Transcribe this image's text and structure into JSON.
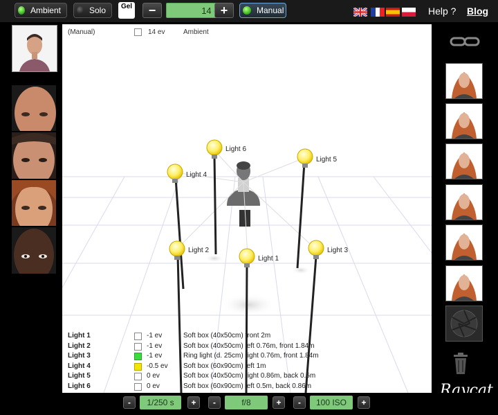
{
  "toolbar": {
    "ambient_label": "Ambient",
    "solo_label": "Solo",
    "gel_label": "Gel",
    "minus": "−",
    "plus": "+",
    "ev_value": "14 ev",
    "manual_label": "Manual",
    "help_label": "Help ?",
    "blog_label": "Blog",
    "flags": [
      "uk-flag-icon",
      "france-flag-icon",
      "spain-flag-icon",
      "poland-flag-icon"
    ]
  },
  "stage": {
    "mode": "(Manual)",
    "ambient_ev": "14 ev",
    "ambient_label": "Ambient",
    "bulbs": [
      {
        "label": "Light 6"
      },
      {
        "label": "Light 5"
      },
      {
        "label": "Light 4"
      },
      {
        "label": "Light 2"
      },
      {
        "label": "Light 1"
      },
      {
        "label": "Light 3"
      }
    ],
    "lights": [
      {
        "name": "Light 1",
        "ev": "-1 ev",
        "desc": "Soft box (40x50cm) front 2m",
        "gel": "#ffffff"
      },
      {
        "name": "Light 2",
        "ev": "-1 ev",
        "desc": "Soft box (40x50cm) left 0.76m, front 1.84m",
        "gel": "#ffffff"
      },
      {
        "name": "Light 3",
        "ev": "-1 ev",
        "desc": "Ring light (d. 25cm) right 0.76m, front 1.84m",
        "gel": "#3ddc3d"
      },
      {
        "name": "Light 4",
        "ev": "-0.5 ev",
        "desc": "Soft box (60x90cm) left 1m",
        "gel": "#f2e600"
      },
      {
        "name": "Light 5",
        "ev": "0 ev",
        "desc": "Soft box (40x50cm) right 0.86m, back 0.5m",
        "gel": "#ffffff"
      },
      {
        "name": "Light 6",
        "ev": "0 ev",
        "desc": "Soft box (60x90cm) left 0.5m, back 0.86m",
        "gel": "#ffffff"
      }
    ]
  },
  "camera": {
    "minus": "-",
    "plus": "+",
    "shutter": "1/250 s",
    "aperture": "f/8",
    "iso": "100 ISO"
  },
  "right": {
    "logo": "Raycat"
  },
  "colors": {
    "accent_green": "#7fc97a",
    "bulb_yellow": "#ffee66",
    "active_green_led": "#3dbb22"
  }
}
